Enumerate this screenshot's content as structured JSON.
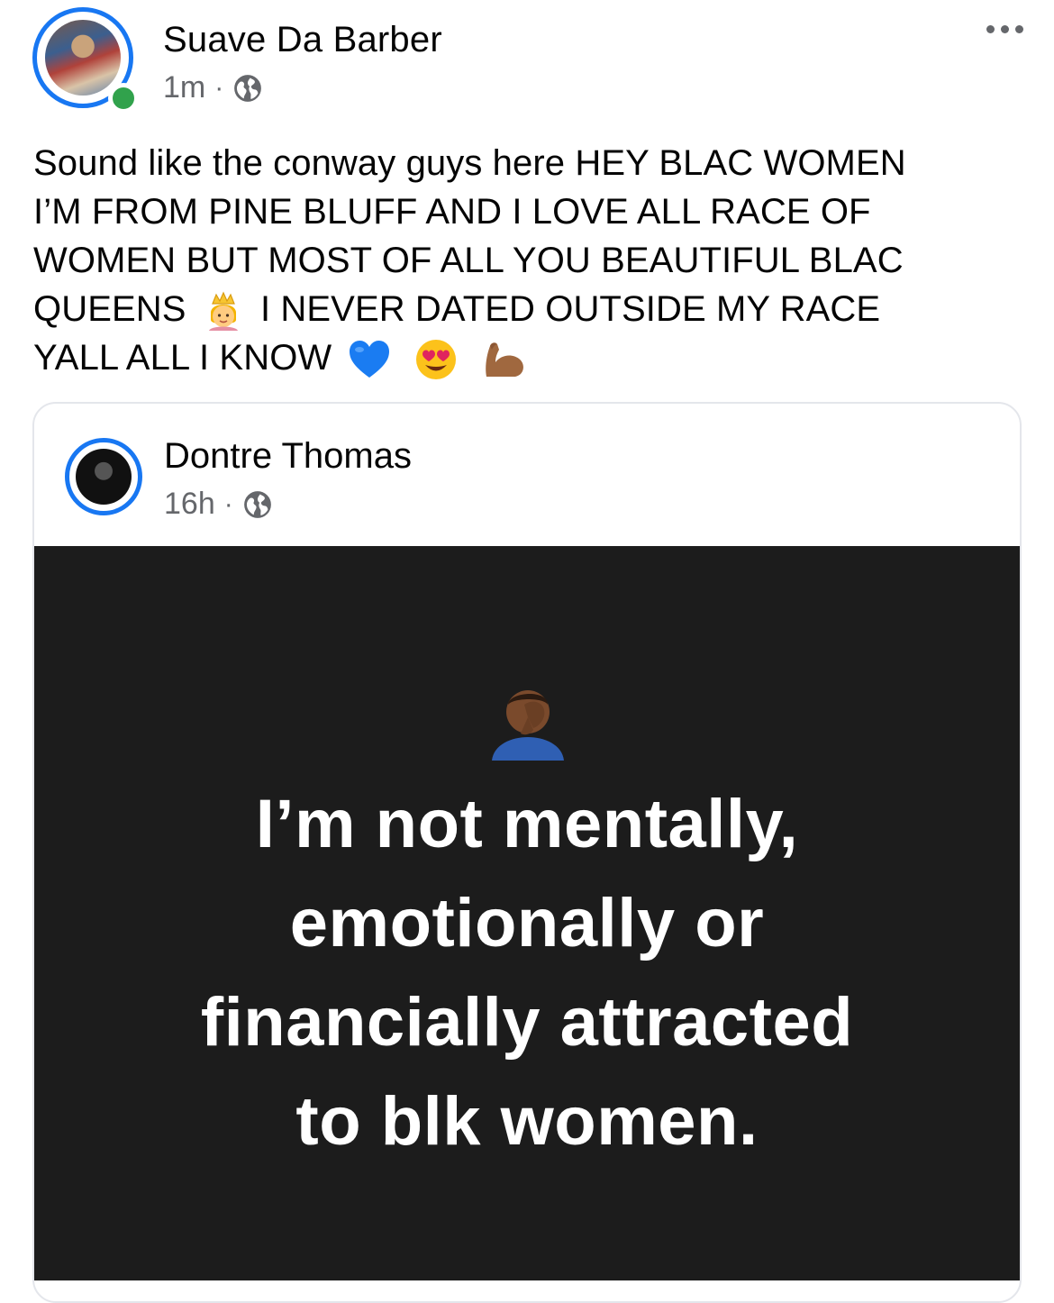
{
  "post": {
    "author": "Suave Da Barber",
    "time": "1m",
    "separator": "·",
    "visibility_icon": "globe-icon",
    "more_icon": "more-options-icon",
    "text_lines": [
      "Sound like the conway guys here HEY BLAC WOMEN",
      "I’M FROM PINE BLUFF AND I LOVE ALL RACE OF",
      "WOMEN BUT MOST OF ALL YOU BEAUTIFUL BLAC",
      "QUEENS",
      "I NEVER DATED OUTSIDE MY RACE",
      "YALL ALL I KNOW"
    ],
    "emojis": [
      "princess-emoji",
      "blue-heart-emoji",
      "heart-eyes-emoji",
      "flexed-biceps-emoji"
    ]
  },
  "shared_post": {
    "author": "Dontre Thomas",
    "time": "16h",
    "separator": "·",
    "visibility_icon": "globe-icon",
    "quote_emoji": "facepalm-emoji",
    "quote_lines": [
      "I’m not mentally,",
      "emotionally or",
      "financially attracted",
      "to blk women."
    ]
  },
  "colors": {
    "accent": "#1877f2",
    "online": "#31a24c",
    "meta_text": "#65676b",
    "quote_background": "#1c1c1c"
  }
}
